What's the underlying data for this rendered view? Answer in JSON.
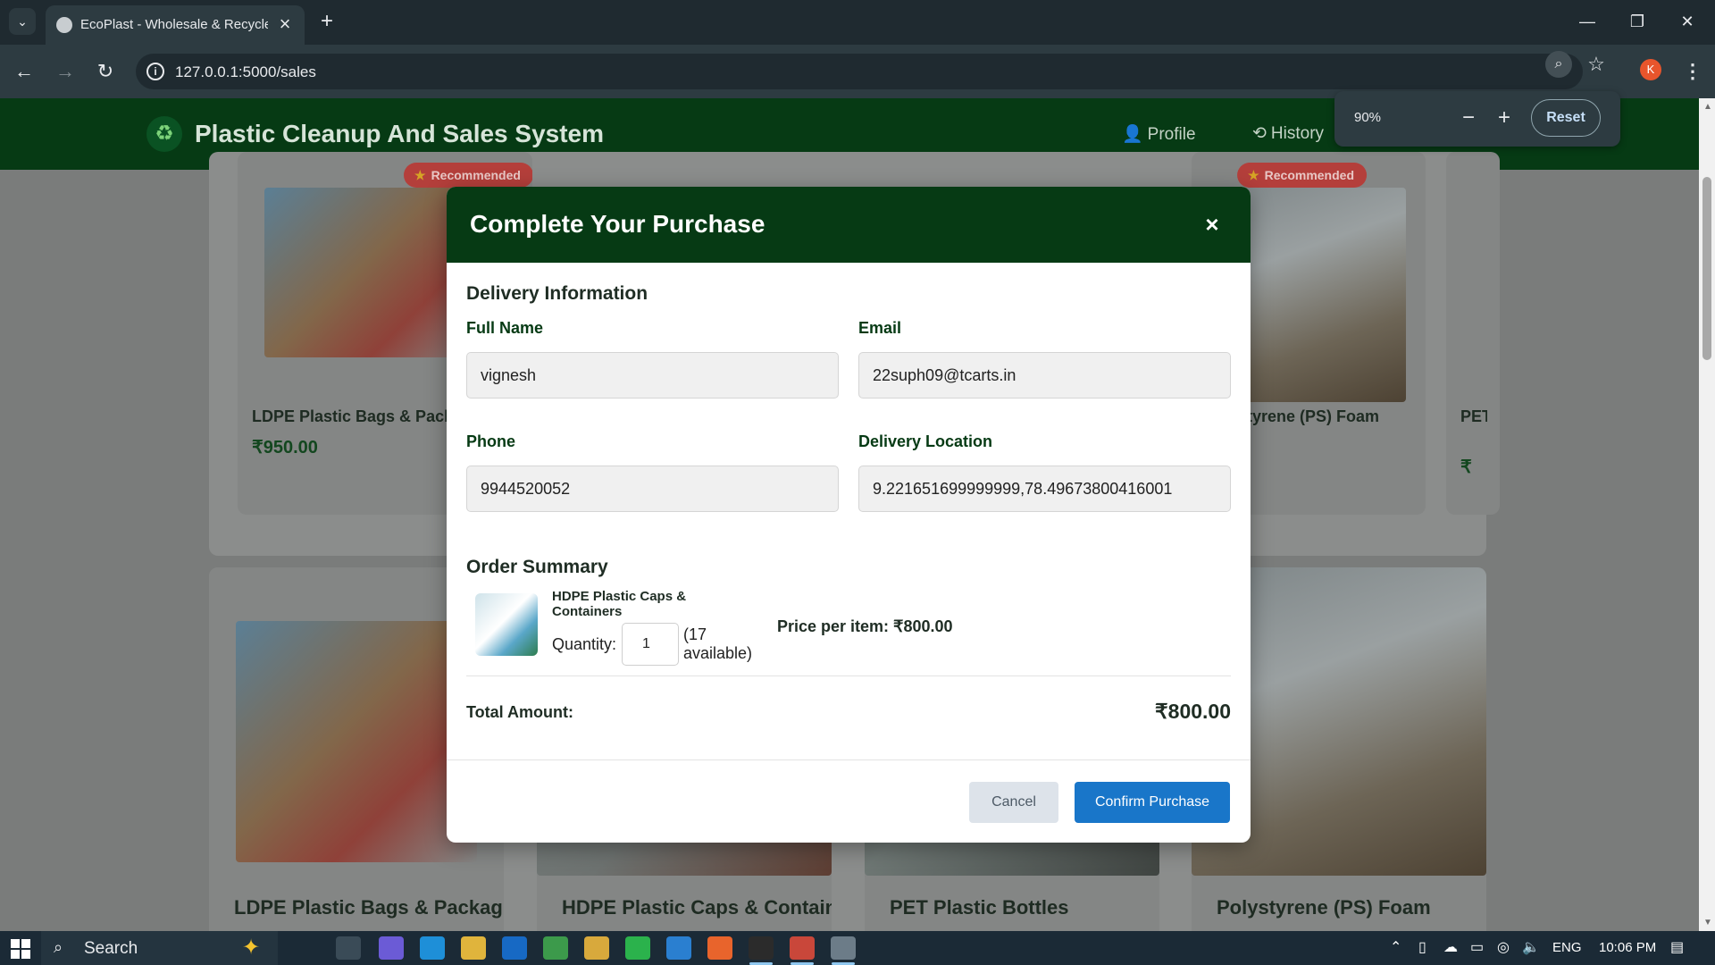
{
  "browser": {
    "tab_title": "EcoPlast - Wholesale & Recycled",
    "url": "127.0.0.1:5000/sales",
    "profile_initial": "K",
    "icons": [
      "tab-menu-icon",
      "globe-icon",
      "close-icon",
      "plus-icon",
      "back-icon",
      "forward-icon",
      "reload-icon",
      "info-icon",
      "zoom-icon",
      "star-icon",
      "menu-icon"
    ]
  },
  "zoom_popup": {
    "level": "90%",
    "minus": "−",
    "plus": "+",
    "reset_label": "Reset"
  },
  "site": {
    "title": "Plastic Cleanup And Sales System",
    "nav": {
      "profile": "Profile",
      "history": "History"
    },
    "colors": {
      "header_bg": "#063a14",
      "badge": "#b43f3b",
      "confirm": "#1976c9"
    }
  },
  "products_row1": [
    {
      "name": "LDPE Plastic Bags & Packaging",
      "price": "₹950.00",
      "badge": "Recommended"
    },
    {
      "name": "Polystyrene (PS) Foam",
      "price": "",
      "badge": "Recommended"
    },
    {
      "name": "PET Plastic Bottles",
      "price": "₹",
      "badge": ""
    }
  ],
  "products_row2": [
    {
      "name": "LDPE Plastic Bags & Packaging"
    },
    {
      "name": "HDPE Plastic Caps & Containers"
    },
    {
      "name": "PET Plastic Bottles"
    },
    {
      "name": "Polystyrene (PS) Foam"
    }
  ],
  "modal": {
    "title": "Complete Your Purchase",
    "close": "×",
    "delivery_heading": "Delivery Information",
    "fields": {
      "full_name_label": "Full Name",
      "full_name_value": "vignesh",
      "email_label": "Email",
      "email_value": "22suph09@tcarts.in",
      "phone_label": "Phone",
      "phone_value": "9944520052",
      "location_label": "Delivery Location",
      "location_value": "9.221651699999999,78.49673800416001"
    },
    "summary": {
      "heading": "Order Summary",
      "product_name": "HDPE Plastic Caps & Containers",
      "quantity_label": "Quantity:",
      "quantity_value": "1",
      "available": "(17 available)",
      "price_per_item": "Price per item: ₹800.00",
      "total_label": "Total Amount:",
      "total_value": "₹800.00"
    },
    "buttons": {
      "cancel": "Cancel",
      "confirm": "Confirm Purchase"
    }
  },
  "taskbar": {
    "search_placeholder": "Search",
    "language": "ENG",
    "time": "10:06 PM"
  }
}
